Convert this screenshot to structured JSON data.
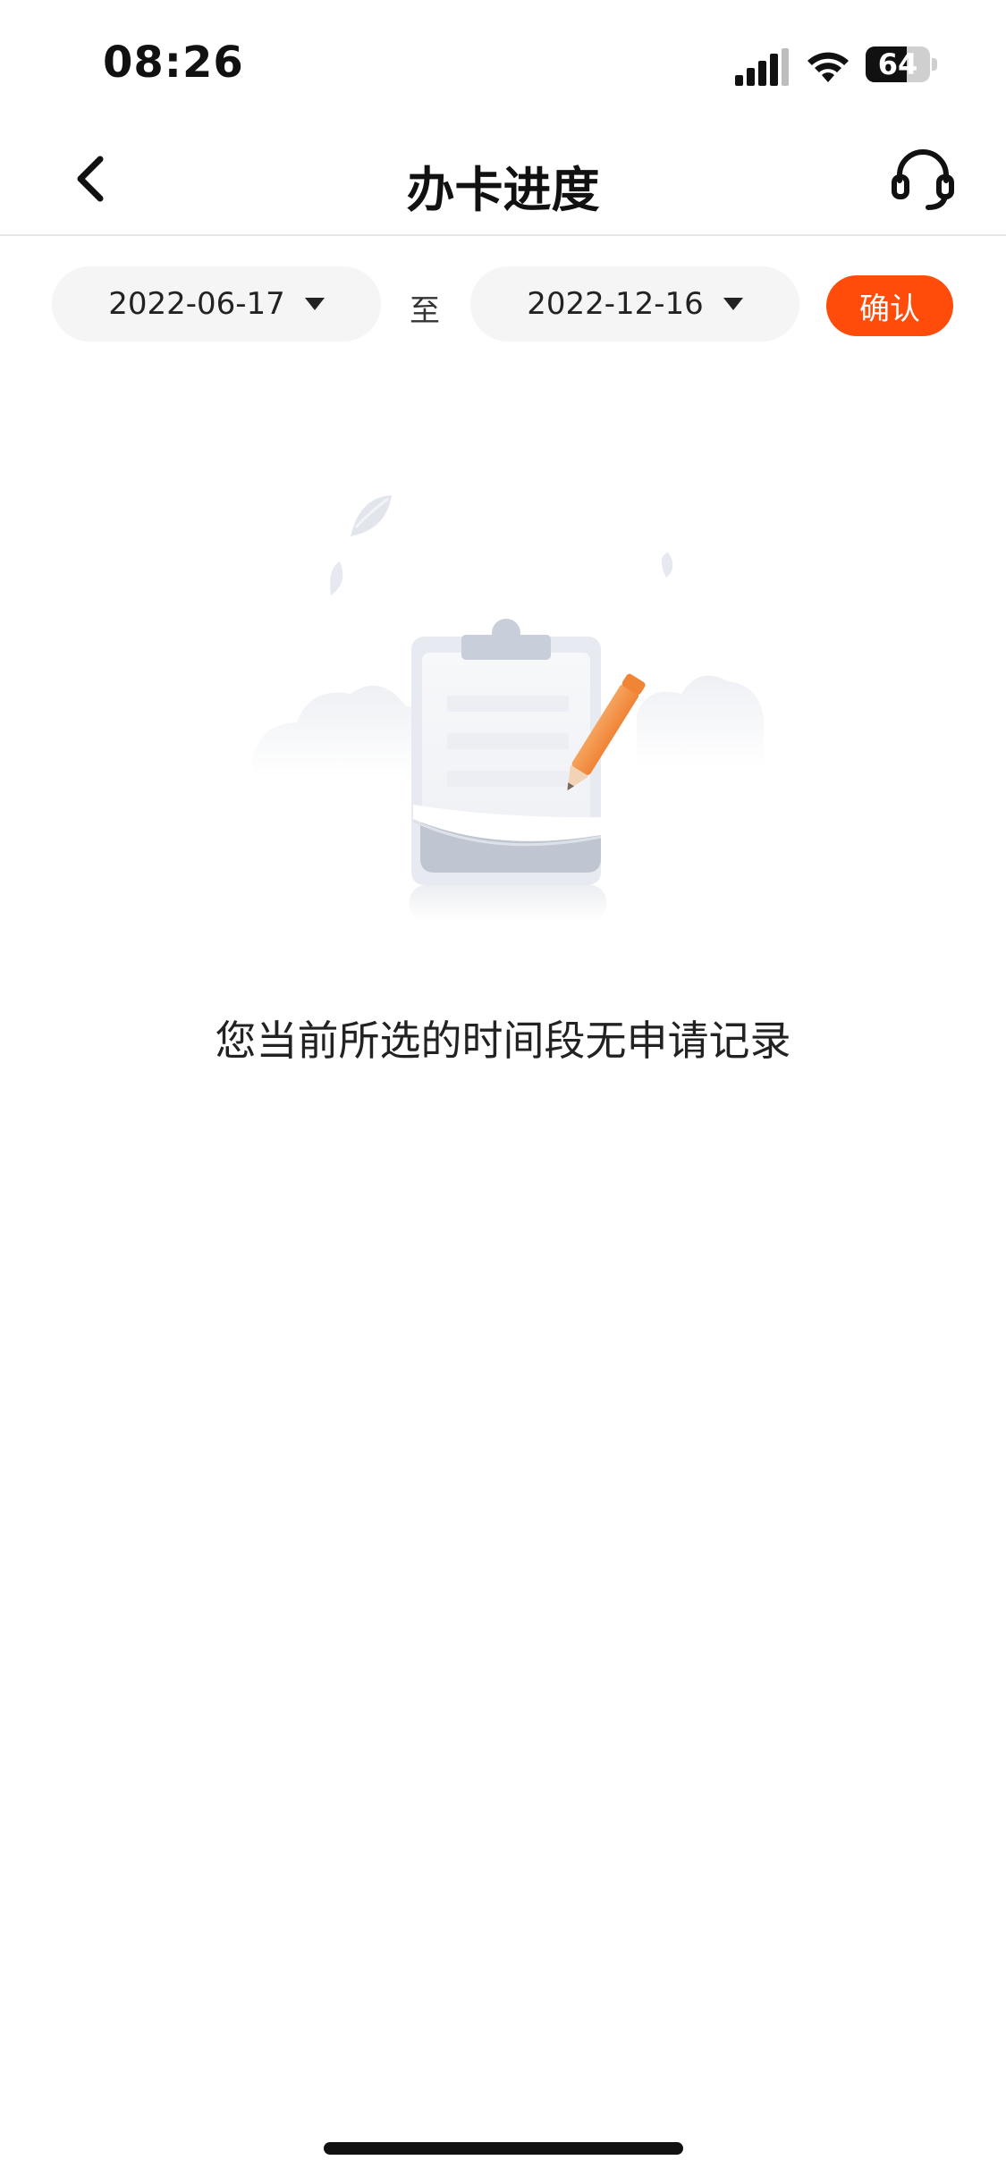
{
  "status_bar": {
    "time": "08:26",
    "battery_level": "64",
    "icons": [
      "signal-icon",
      "wifi-icon",
      "battery-icon"
    ]
  },
  "nav": {
    "title": "办卡进度",
    "back_icon": "chevron-left-icon",
    "service_icon": "headset-icon"
  },
  "filter": {
    "start_date": "2022-06-17",
    "separator": "至",
    "end_date": "2022-12-16",
    "confirm_label": "确认"
  },
  "empty_state": {
    "illustration": "clipboard-pencil-illustration",
    "message": "您当前所选的时间段无申请记录"
  },
  "colors": {
    "accent": "#ff4c0a",
    "pill_bg": "#f5f5f5",
    "text": "#222222"
  }
}
